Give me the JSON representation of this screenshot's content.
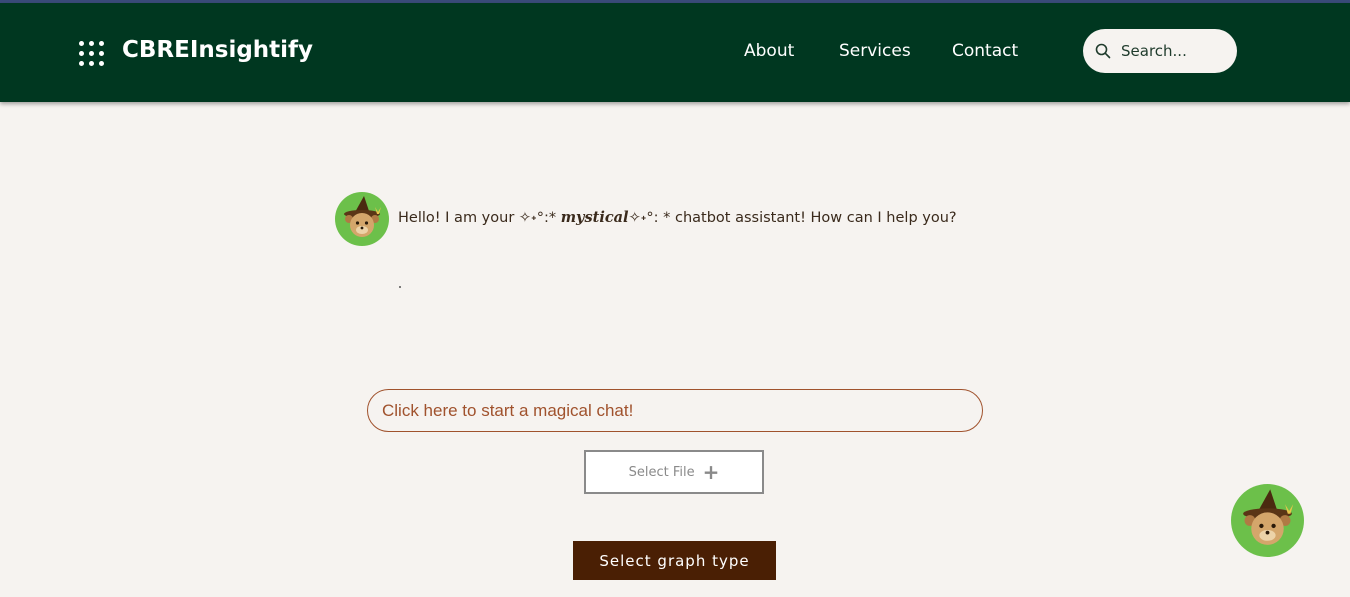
{
  "header": {
    "brand": "CBREInsightify",
    "nav": [
      "About",
      "Services",
      "Contact"
    ],
    "search_placeholder": "Search..."
  },
  "chat": {
    "greeting_pre": "Hello! I am your ✧˖°:* ",
    "greeting_fancy": "mystical",
    "greeting_post": "✧˖°: * chatbot assistant! How can I help you?",
    "input_placeholder": "Click here to start a magical chat!",
    "select_file_label": "Select File",
    "select_graph_label": "Select graph type"
  },
  "colors": {
    "header_bg": "#003720",
    "page_bg": "#f6f3f0",
    "avatar_bg": "#6cc04a",
    "accent_brown": "#a0522d",
    "graph_button_bg": "#4a1f04"
  },
  "icons": {
    "logo": "grid-dots-icon",
    "search": "search-icon",
    "avatar": "wizard-bear-icon",
    "plus": "plus-icon"
  }
}
